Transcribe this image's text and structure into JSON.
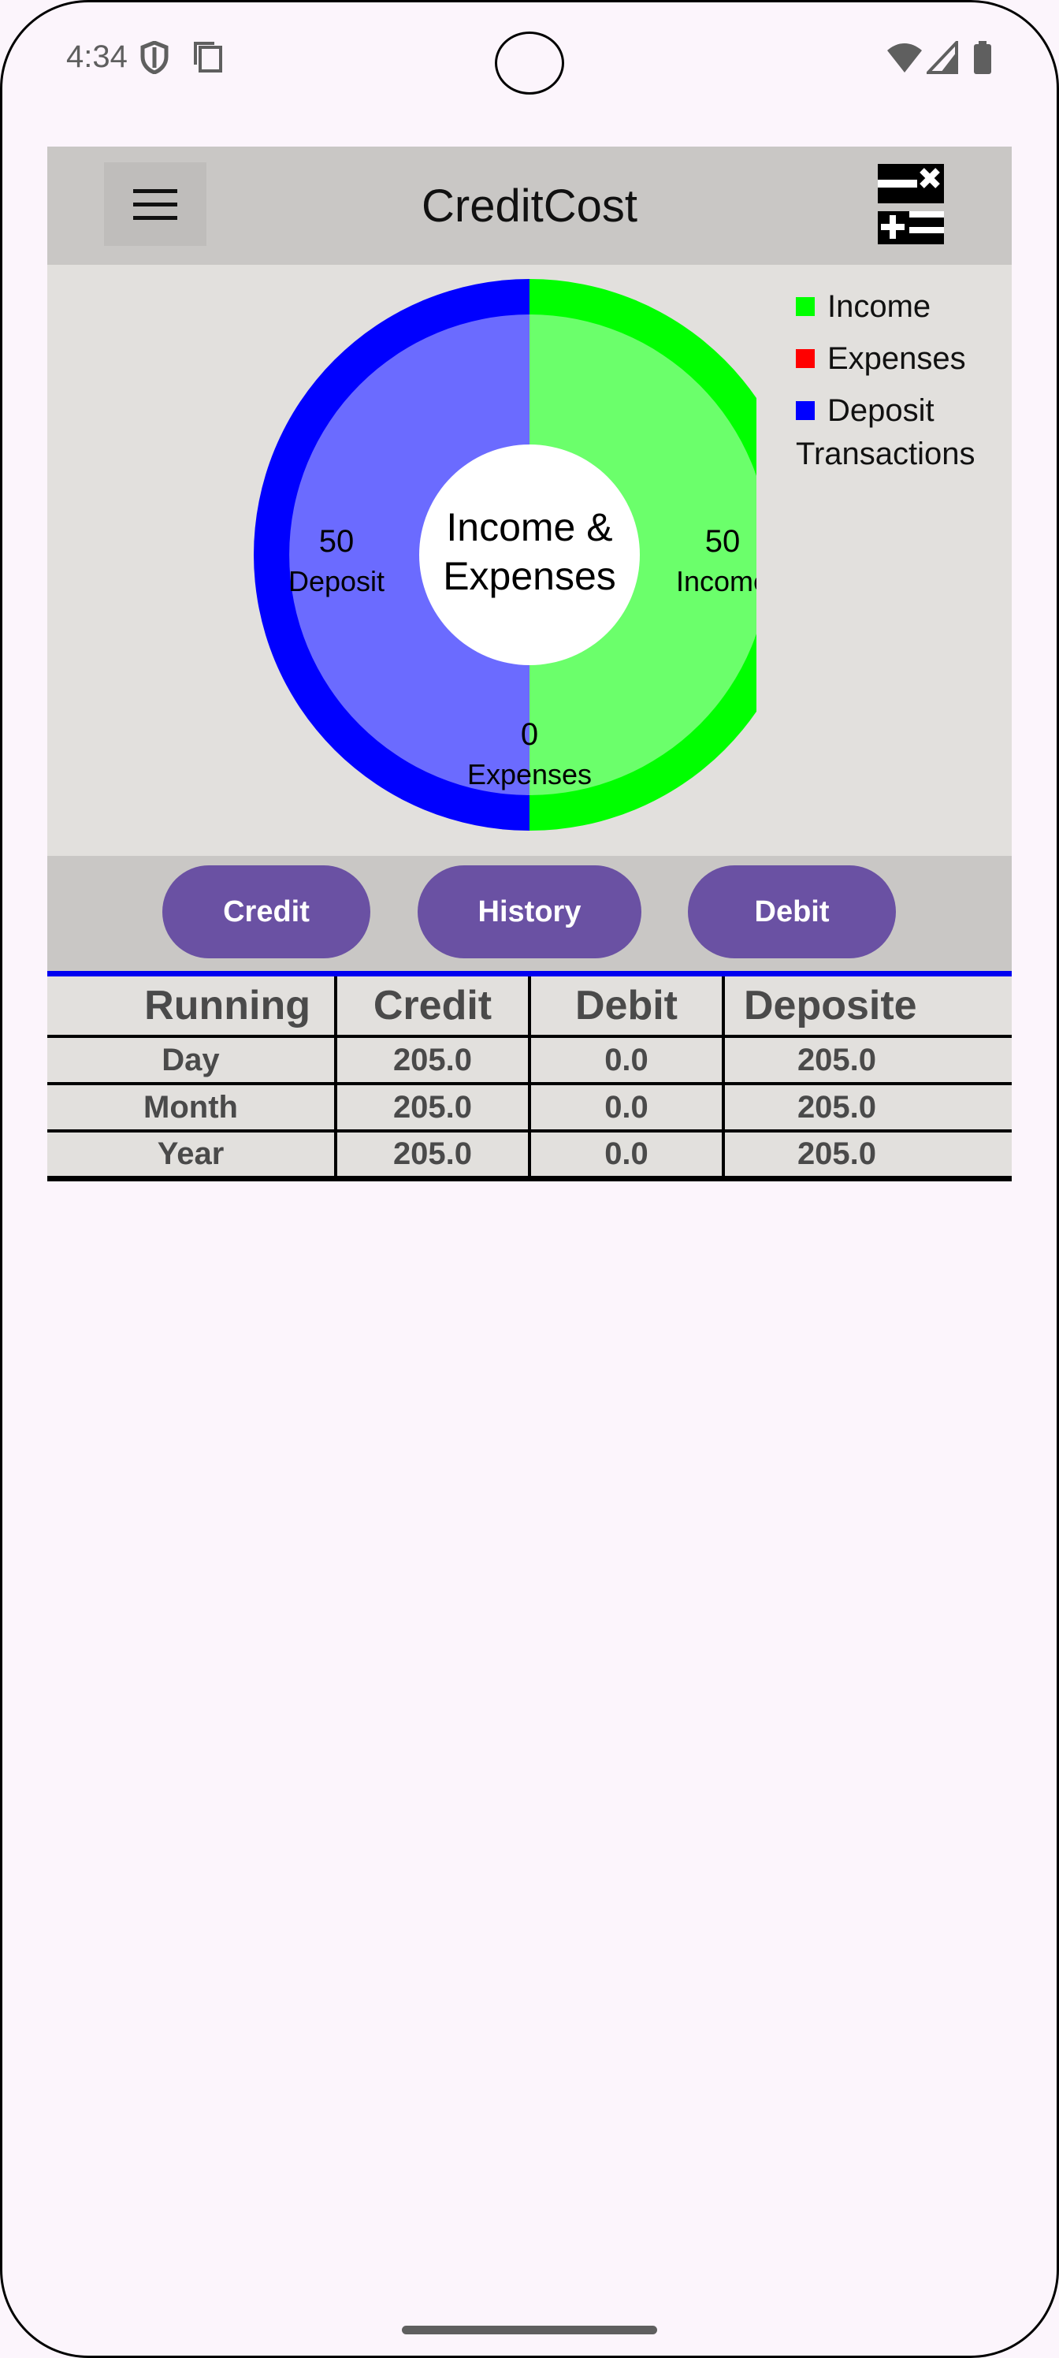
{
  "status_bar": {
    "time": "4:34",
    "icons": [
      "shield-icon",
      "clipboard-icon",
      "wifi-icon",
      "signal-icon",
      "battery-icon"
    ]
  },
  "app_bar": {
    "title": "CreditCost",
    "menu_icon": "hamburger-menu-icon",
    "logo_icon": "calculator-logo-icon"
  },
  "chart": {
    "center_title_line1": "Income &",
    "center_title_line2": "Expenses",
    "legend_caption": "Transactions",
    "legend": [
      {
        "label": "Income",
        "color": "#00ff00"
      },
      {
        "label": "Expenses",
        "color": "#ff0000"
      },
      {
        "label": "Deposit",
        "color": "#0000ff"
      }
    ]
  },
  "chart_data": {
    "type": "pie",
    "title": "Income & Expenses",
    "categories": [
      "Income",
      "Expenses",
      "Deposit"
    ],
    "values": [
      50,
      0,
      50
    ],
    "colors": [
      "#00ff00",
      "#ff0000",
      "#0000ff"
    ],
    "inner_colors": [
      "#6bff6b",
      "#ff6b6b",
      "#6b6bff"
    ],
    "legend_title": "Transactions",
    "legend_position": "top-right"
  },
  "buttons": {
    "credit": "Credit",
    "history": "History",
    "debit": "Debit"
  },
  "table": {
    "headers": [
      "Running",
      "Credit",
      "Debit",
      "Deposite"
    ],
    "rows": [
      [
        "Day",
        "205.0",
        "0.0",
        "205.0"
      ],
      [
        "Month",
        "205.0",
        "0.0",
        "205.0"
      ],
      [
        "Year",
        "205.0",
        "0.0",
        "205.0"
      ]
    ]
  }
}
